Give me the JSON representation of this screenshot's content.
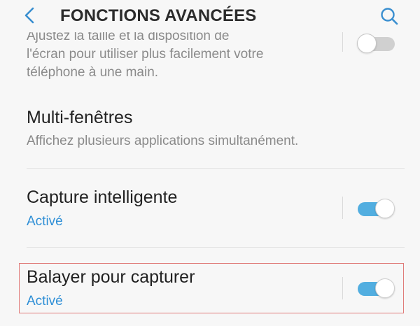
{
  "header": {
    "title": "FONCTIONS AVANCÉES",
    "back_icon": "chevron-left-icon",
    "search_icon": "search-icon"
  },
  "colors": {
    "background": "#f7f7f7",
    "accent": "#2f8fd6",
    "switch_on": "#52aee0",
    "switch_off": "#d0d0d0",
    "highlight": "#e07a78"
  },
  "settings": {
    "one_hand": {
      "summary_lines": [
        "Ajustez la taille et la disposition de",
        "l'écran pour utiliser plus facilement votre",
        "téléphone à une main."
      ],
      "enabled": false
    },
    "multi_window": {
      "title": "Multi-fenêtres",
      "summary": "Affichez plusieurs applications simultanément."
    },
    "smart_capture": {
      "title": "Capture intelligente",
      "status": "Activé",
      "enabled": true
    },
    "palm_swipe": {
      "title": "Balayer pour capturer",
      "status": "Activé",
      "enabled": true
    }
  }
}
